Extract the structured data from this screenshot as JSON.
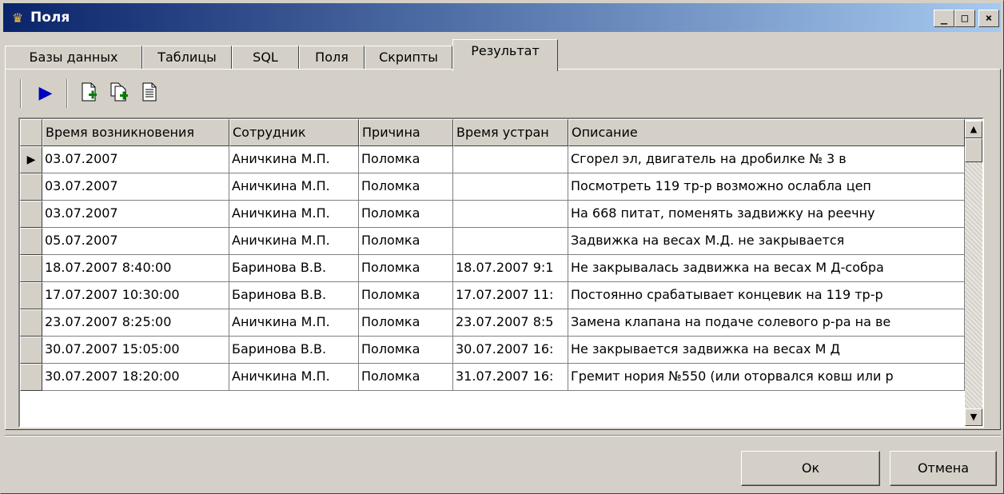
{
  "window": {
    "title": "Поля"
  },
  "titlebar_buttons": {
    "minimize": "_",
    "maximize": "□",
    "close": "×"
  },
  "tabs": [
    {
      "label": "Базы данных"
    },
    {
      "label": "Таблицы"
    },
    {
      "label": "SQL"
    },
    {
      "label": "Поля"
    },
    {
      "label": "Скрипты"
    },
    {
      "label": "Результат",
      "active": true
    }
  ],
  "toolbar": {
    "icons": [
      "run-icon",
      "new-doc-icon",
      "copy-doc-icon",
      "doc-icon"
    ]
  },
  "grid": {
    "columns": [
      "Время возникновения",
      "Сотрудник",
      "Причина",
      "Время устран",
      "Описание"
    ],
    "rows": [
      [
        "03.07.2007",
        "Аничкина М.П.",
        "Поломка",
        "",
        "Сгорел эл, двигатель на дробилке № 3      в"
      ],
      [
        "03.07.2007",
        "Аничкина М.П.",
        "Поломка",
        "",
        "Посмотреть 119 тр-р  возможно ослабла цеп"
      ],
      [
        "03.07.2007",
        "Аничкина М.П.",
        "Поломка",
        "",
        "На 668 питат, поменять задвижку на реечну"
      ],
      [
        "05.07.2007",
        "Аничкина М.П.",
        "Поломка",
        "",
        "Задвижка на весах М.Д. не закрывается"
      ],
      [
        "18.07.2007 8:40:00",
        "Баринова В.В.",
        "Поломка",
        "18.07.2007 9:1",
        "Не закрывалась  задвижка на весах М Д-собра"
      ],
      [
        "17.07.2007 10:30:00",
        "Баринова В.В.",
        "Поломка",
        "17.07.2007 11:",
        "Постоянно срабатывает концевик  на 119  тр-р"
      ],
      [
        "23.07.2007 8:25:00",
        "Аничкина М.П.",
        "Поломка",
        "23.07.2007 8:5",
        "Замена клапана на подаче солевого р-ра на ве"
      ],
      [
        "30.07.2007 15:05:00",
        "Баринова В.В.",
        "Поломка",
        "30.07.2007 16:",
        "Не закрывается  задвижка   на весах  М Д"
      ],
      [
        "30.07.2007 18:20:00",
        "Аничкина М.П.",
        "Поломка",
        "31.07.2007 16:",
        "Гремит нория №550 (или оторвался ковш или р"
      ]
    ],
    "current_row_marker": "▶",
    "scroll_up": "▲",
    "scroll_down": "▼"
  },
  "buttons": {
    "ok": "Ок",
    "cancel": "Отмена"
  },
  "colors": {
    "titlebar_start": "#0a246a",
    "titlebar_end": "#a6caf0",
    "run_icon": "#0000c0"
  }
}
